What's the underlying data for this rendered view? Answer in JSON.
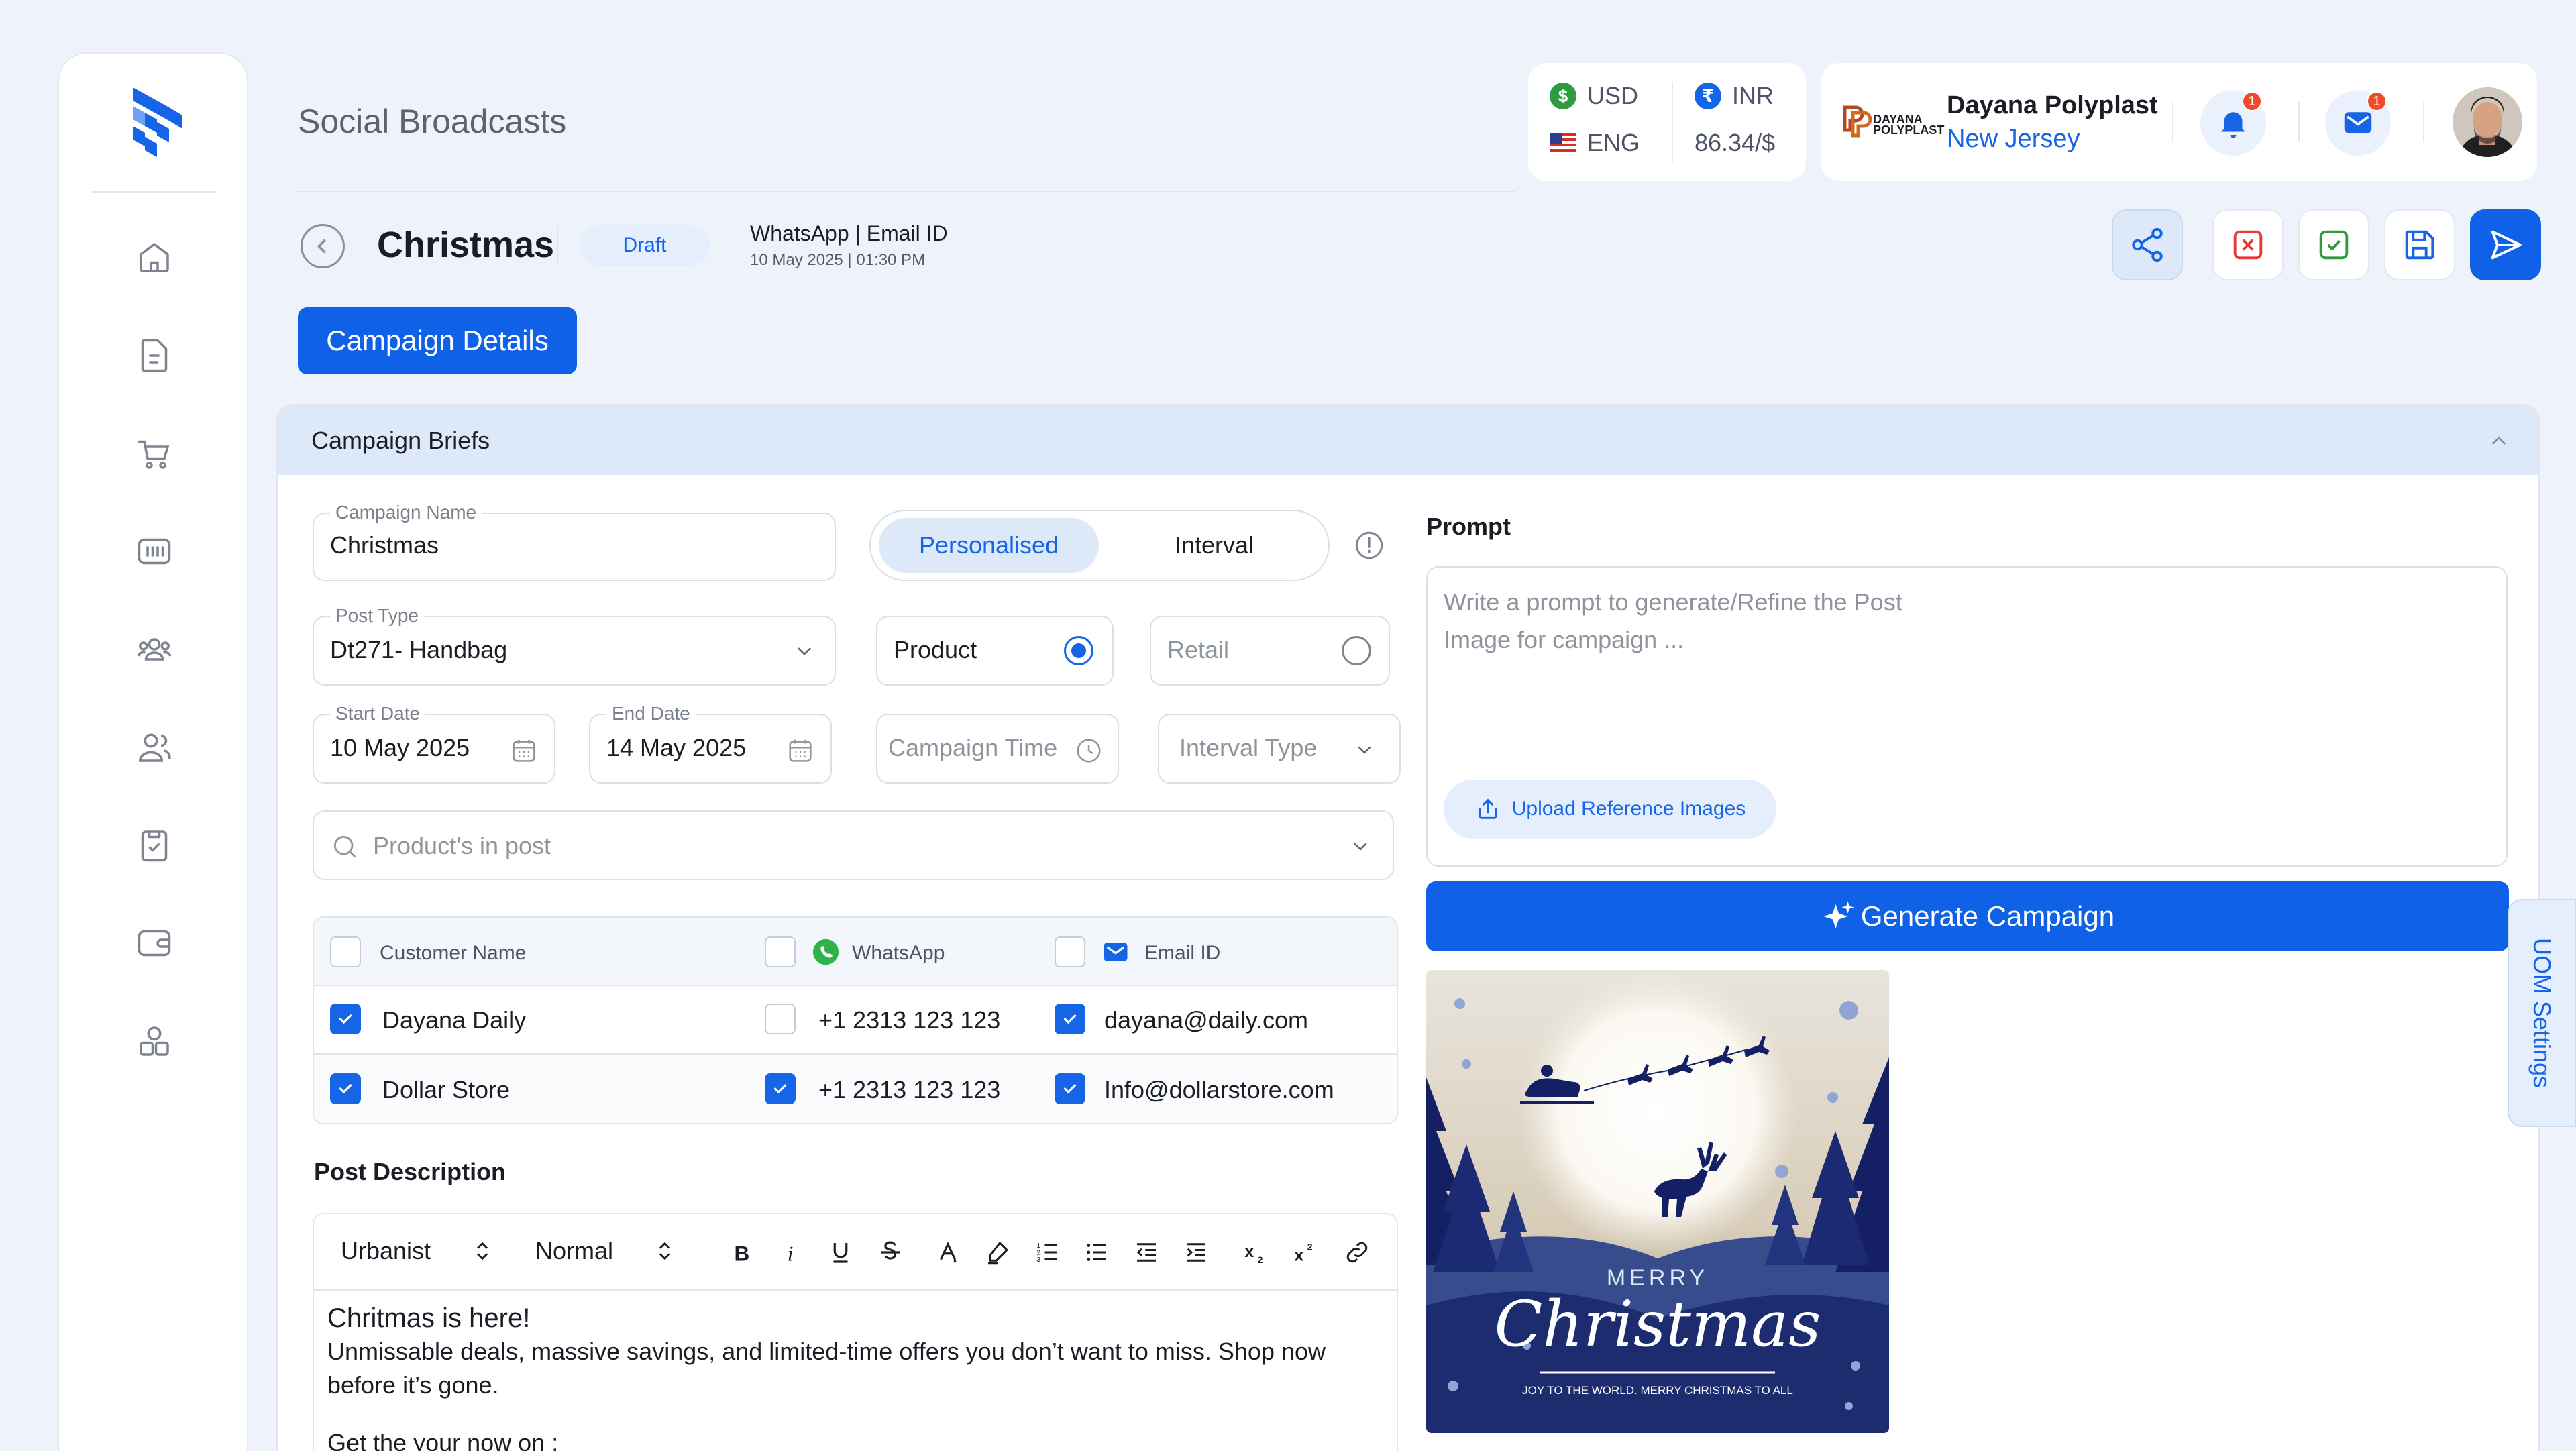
{
  "header": {
    "page_title": "Social Broadcasts",
    "currency": {
      "base_code": "USD",
      "language": "ENG",
      "target_code": "INR",
      "rate": "86.34/$"
    },
    "company": {
      "name": "Dayana Polyplast",
      "location": "New Jersey",
      "logo_text": "DAYANA POLYPLAST"
    },
    "notifications_count": "1",
    "messages_count": "1"
  },
  "campaign": {
    "title": "Christmas",
    "status": "Draft",
    "channels": "WhatsApp | Email ID",
    "date": "10 May 2025 | 01:30 PM"
  },
  "tabs": {
    "active": "Campaign Details"
  },
  "panel": {
    "title": "Campaign Briefs"
  },
  "form": {
    "campaign_name_label": "Campaign Name",
    "campaign_name_value": "Christmas",
    "mode_personalised": "Personalised",
    "mode_interval": "Interval",
    "post_type_label": "Post Type",
    "post_type_value": "Dt271- Handbag",
    "product_label": "Product",
    "retail_label": "Retail",
    "start_date_label": "Start Date",
    "start_date_value": "10 May 2025",
    "end_date_label": "End Date",
    "end_date_value": "14 May 2025",
    "campaign_time_placeholder": "Campaign Time",
    "interval_type_placeholder": "Interval Type",
    "products_placeholder": "Product's in post"
  },
  "table": {
    "headers": [
      "Customer Name",
      "WhatsApp",
      "Email ID"
    ],
    "rows": [
      {
        "name": "Dayana Daily",
        "whatsapp": "+1 2313 123 123",
        "email": "dayana@daily.com"
      },
      {
        "name": "Dollar Store",
        "whatsapp": "+1 2313 123 123",
        "email": "Info@dollarstore.com"
      }
    ]
  },
  "editor": {
    "label": "Post Description",
    "font": "Urbanist",
    "size": "Normal",
    "content_title": "Chritmas is here!",
    "content_body": "Unmissable deals, massive savings, and limited-time offers you don’t want to miss. Shop now before it’s gone.",
    "content_line3": "Get the your now on :"
  },
  "prompt": {
    "label": "Prompt",
    "placeholder": "Write a prompt to generate/Refine the Post Image for campaign ...",
    "upload_label": "Upload Reference Images",
    "generate_label": "Generate Campaign"
  },
  "post_image": {
    "merry": "MERRY",
    "christmas": "Christmas",
    "tagline": "JOY TO THE WORLD. MERRY CHRISTMAS TO ALL"
  },
  "uom_label": "UOM Settings",
  "colors": {
    "primary": "#0f62e8",
    "accent_light": "#e4eefc",
    "danger": "#e53935",
    "success": "#2e9b3f",
    "badge": "#ef4b2a"
  },
  "icons": {
    "sidebar": [
      "home-icon",
      "document-icon",
      "cart-icon",
      "barcode-icon",
      "users-group-icon",
      "users-icon",
      "clipboard-icon",
      "wallet-icon",
      "apps-icon"
    ],
    "actions": [
      "share-icon",
      "close-icon",
      "check-icon",
      "save-icon",
      "send-icon"
    ]
  }
}
